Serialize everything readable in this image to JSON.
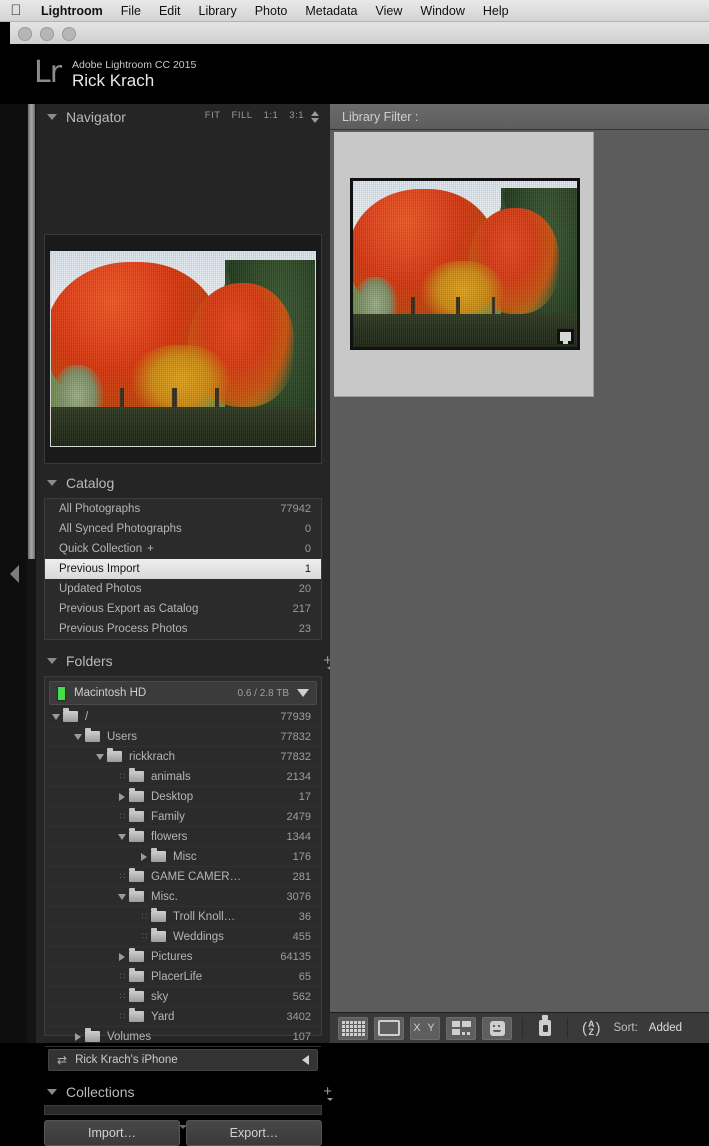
{
  "menubar": {
    "apple_icon": "apple-icon",
    "items": [
      {
        "label": "Lightroom",
        "bold": true
      },
      {
        "label": "File"
      },
      {
        "label": "Edit"
      },
      {
        "label": "Library"
      },
      {
        "label": "Photo"
      },
      {
        "label": "Metadata"
      },
      {
        "label": "View"
      },
      {
        "label": "Window"
      },
      {
        "label": "Help"
      }
    ]
  },
  "identity": {
    "logo": "Lr",
    "product": "Adobe Lightroom CC 2015",
    "user": "Rick Krach"
  },
  "navigator": {
    "title": "Navigator",
    "zoom_levels": [
      "FIT",
      "FILL",
      "1:1",
      "3:1"
    ]
  },
  "catalog": {
    "title": "Catalog",
    "items": [
      {
        "label": "All Photographs",
        "count": "77942",
        "selected": false
      },
      {
        "label": "All Synced Photographs",
        "count": "0",
        "selected": false
      },
      {
        "label": "Quick Collection",
        "count": "0",
        "selected": false,
        "plus": "+"
      },
      {
        "label": "Previous Import",
        "count": "1",
        "selected": true
      },
      {
        "label": "Updated Photos",
        "count": "20",
        "selected": false
      },
      {
        "label": "Previous Export as Catalog",
        "count": "217",
        "selected": false
      },
      {
        "label": "Previous Process Photos",
        "count": "23",
        "selected": false
      }
    ]
  },
  "folders": {
    "title": "Folders",
    "volume": {
      "name": "Macintosh HD",
      "space": "0.6 / 2.8 TB",
      "led_color": "#43e04a"
    },
    "tree": [
      {
        "label": "/",
        "count": "77939",
        "indent": 0,
        "state": "open"
      },
      {
        "label": "Users",
        "count": "77832",
        "indent": 1,
        "state": "open"
      },
      {
        "label": "rickkrach",
        "count": "77832",
        "indent": 2,
        "state": "open"
      },
      {
        "label": "animals",
        "count": "2134",
        "indent": 3,
        "state": "leaf"
      },
      {
        "label": "Desktop",
        "count": "17",
        "indent": 3,
        "state": "closed"
      },
      {
        "label": "Family",
        "count": "2479",
        "indent": 3,
        "state": "leaf"
      },
      {
        "label": "flowers",
        "count": "1344",
        "indent": 3,
        "state": "open"
      },
      {
        "label": "Misc",
        "count": "176",
        "indent": 4,
        "state": "closed"
      },
      {
        "label": "GAME CAMER…",
        "count": "281",
        "indent": 3,
        "state": "leaf"
      },
      {
        "label": "Misc.",
        "count": "3076",
        "indent": 3,
        "state": "open"
      },
      {
        "label": "Troll Knoll…",
        "count": "36",
        "indent": 4,
        "state": "leaf"
      },
      {
        "label": "Weddings",
        "count": "455",
        "indent": 4,
        "state": "leaf"
      },
      {
        "label": "Pictures",
        "count": "64135",
        "indent": 3,
        "state": "closed"
      },
      {
        "label": "PlacerLife",
        "count": "65",
        "indent": 3,
        "state": "leaf"
      },
      {
        "label": "sky",
        "count": "562",
        "indent": 3,
        "state": "leaf"
      },
      {
        "label": "Yard",
        "count": "3402",
        "indent": 3,
        "state": "leaf"
      },
      {
        "label": "Volumes",
        "count": "107",
        "indent": 1,
        "state": "closed"
      }
    ],
    "device": {
      "label": "Rick Krach's iPhone",
      "icon": "sync-arrows-icon"
    }
  },
  "collections": {
    "title": "Collections"
  },
  "panel_buttons": {
    "import": "Import…",
    "export": "Export…"
  },
  "library_filter": {
    "label": "Library Filter :"
  },
  "toolbar": {
    "view_modes": [
      {
        "name": "grid-view",
        "icon": "grid-icon"
      },
      {
        "name": "loupe-view",
        "icon": "loupe-icon"
      },
      {
        "name": "compare-view",
        "icon": "xy-icon",
        "text": "X Y"
      },
      {
        "name": "survey-view",
        "icon": "survey-icon"
      },
      {
        "name": "people-view",
        "icon": "face-icon"
      }
    ],
    "painter": "spray-can-icon",
    "sort_icon": "az-sort-icon",
    "sort_label": "Sort:",
    "sort_value": "Added"
  },
  "colors": {
    "panel_bg": "#252525",
    "content_bg": "#5c5c5c",
    "cell_bg": "#c8c8c8",
    "selection": "#e6e6e6",
    "accent_green": "#43e04a"
  }
}
